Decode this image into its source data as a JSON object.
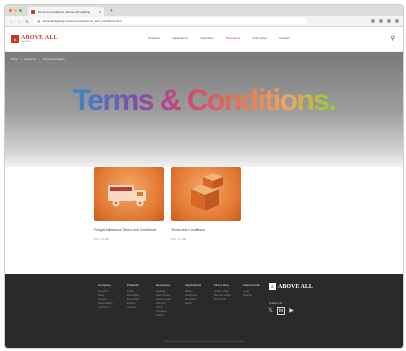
{
  "browser": {
    "tab_title": "Terms & Conditions | Above All Lighting",
    "tab_close": "×",
    "new_tab": "+",
    "url": "aboveall lighting.com/resources/terms_and_conditions.html",
    "nav": {
      "back": "‹",
      "forward": "›",
      "reload": "↻"
    },
    "traffic_colors": [
      "#ff5f57",
      "#febc2e",
      "#28c840"
    ]
  },
  "header": {
    "logo_mark": "A",
    "logo_text": "ABOVE ALL",
    "logo_sub": "LIGHTING",
    "nav": [
      {
        "label": "Products",
        "active": false
      },
      {
        "label": "Applications",
        "active": false
      },
      {
        "label": "Inspiration",
        "active": false
      },
      {
        "label": "Resources",
        "active": true
      },
      {
        "label": "Find a Rep",
        "active": false
      },
      {
        "label": "Contact",
        "active": false
      }
    ],
    "search_icon": "search-icon"
  },
  "hero": {
    "breadcrumb": [
      "Home",
      "/",
      "Resources",
      "/",
      "Terms & Conditions"
    ],
    "title": "Terms & Conditions."
  },
  "cards": [
    {
      "title": "Freight Allowance Terms and Conditions",
      "meta": "PDF | 1.8 MB",
      "thumb_label": "FREIGHT ALLOWANCE",
      "icon": "truck-icon"
    },
    {
      "title": "Terms and Conditions",
      "meta": "PDF | 1.2 MB",
      "thumb_label": "",
      "icon": "boxes-icon"
    }
  ],
  "footer": {
    "columns": [
      {
        "heading": "Company",
        "items": [
          "About Us",
          "News",
          "Careers",
          "Sustainability",
          "Contact Us"
        ]
      },
      {
        "heading": "Products",
        "items": [
          "Linear",
          "Downlights",
          "Decorative",
          "Exterior",
          "Controls"
        ]
      },
      {
        "heading": "Resources",
        "items": [
          "Catalogs",
          "Spec Sheets",
          "Install Guides",
          "Warranty",
          "Terms",
          "Literature",
          "Videos"
        ]
      },
      {
        "heading": "Applications",
        "items": [
          "Office",
          "Healthcare",
          "Education",
          "Retail"
        ]
      },
      {
        "heading": "Find a Rep",
        "items": [
          "Locate a Rep",
          "Become a Rep",
          "Rep Portal"
        ]
      },
      {
        "heading": "Client Portal",
        "items": [
          "Login",
          "Register"
        ]
      }
    ],
    "logo_mark": "A",
    "logo_text": "ABOVE ALL",
    "follow_label": "Follow Us",
    "socials": [
      {
        "icon": "twitter-icon",
        "glyph": "🐦"
      },
      {
        "icon": "linkedin-icon",
        "glyph": "in"
      },
      {
        "icon": "youtube-icon",
        "glyph": "▶"
      }
    ],
    "copyright": "© Above All Lighting, Inc. All Rights Reserved. | Privacy Policy | Terms of Use | Accessibility"
  },
  "colors": {
    "brand_red": "#c0392b",
    "footer_bg": "#2a2a2a",
    "thumb_orange": "#e0762e"
  }
}
